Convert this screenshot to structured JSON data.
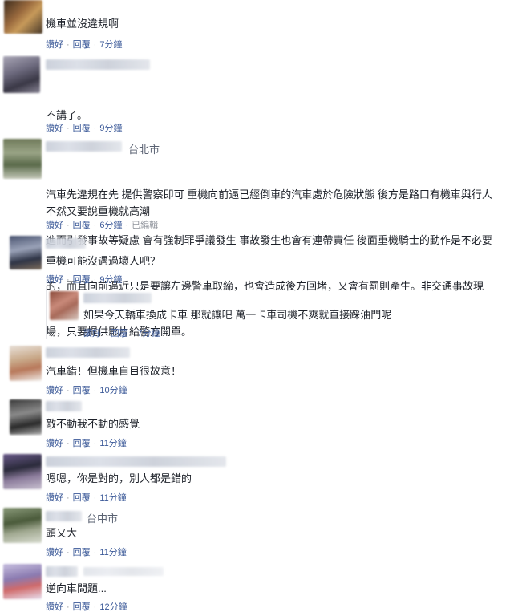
{
  "ui": {
    "like": "讚好",
    "reply": "回覆",
    "sep": "·"
  },
  "comments": [
    {
      "location": "",
      "lines": [
        "機車並沒違規啊"
      ],
      "time": "7分鐘",
      "edited": ""
    },
    {
      "location": "",
      "lines": [
        "不講了。",
        "",
        "不然又要說重機就高潮"
      ],
      "time": "9分鐘",
      "edited": ""
    },
    {
      "location": "台北市",
      "lines": [
        "汽車先違規在先 提供警察即可 重機向前逼已經倒車的汽車處於危險狀態 後方是路口有機車與行人",
        "進而引發事故等疑慮 會有強制罪爭議發生 事故發生也會有連帶責任 後面重機騎士的動作是不必要",
        "的，而且向前逼近只是要讓左邊警車取締，也會造成後方回堵，又會有罰則產生。非交通事故現",
        "場，只要提供影片給警方開單。"
      ],
      "time": "6分鐘",
      "edited": "已編輯"
    },
    {
      "location": "",
      "lines": [
        "重機可能沒遇過壞人吧？"
      ],
      "time": "9分鐘",
      "edited": ""
    },
    {
      "location": "",
      "lines": [
        "如果今天轎車換成卡車 那就讓吧 萬一卡車司機不爽就直接踩油門呢"
      ],
      "time": "7分鐘",
      "edited": ""
    },
    {
      "location": "",
      "lines": [
        "汽車錯！但機車自目很故意！"
      ],
      "time": "10分鐘",
      "edited": ""
    },
    {
      "location": "",
      "lines": [
        "敵不動我不動的感覺"
      ],
      "time": "11分鐘",
      "edited": ""
    },
    {
      "location": "",
      "lines": [
        "嗯嗯，你是對的，別人都是錯的"
      ],
      "time": "11分鐘",
      "edited": ""
    },
    {
      "location": "台中市",
      "lines": [
        "頭又大"
      ],
      "time": "11分鐘",
      "edited": ""
    },
    {
      "location": "",
      "lines": [
        "逆向車問題..."
      ],
      "time": "12分鐘",
      "edited": ""
    }
  ],
  "colors": {
    "link": "#3b5998",
    "meta": "#90949c",
    "text": "#1d2129"
  }
}
